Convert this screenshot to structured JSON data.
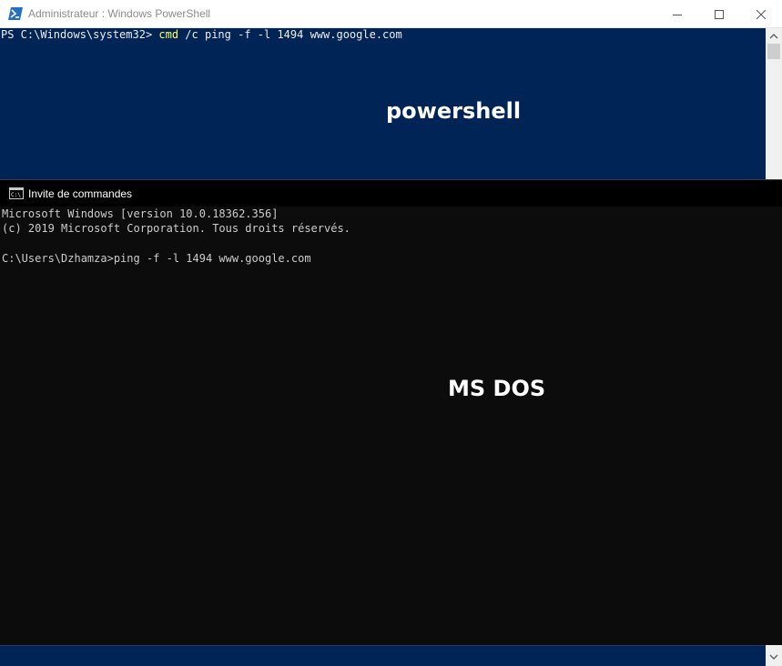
{
  "powershell": {
    "title": "Administrateur : Windows PowerShell",
    "prompt": "PS C:\\Windows\\system32> ",
    "command_keyword": "cmd",
    "command_args": " /c ping -f -l 1494 www.google.com",
    "overlay_label": "powershell",
    "icons": {
      "app": "powershell-icon",
      "minimize": "minimize-icon",
      "maximize": "maximize-icon",
      "close": "close-icon",
      "scroll_up": "chevron-up-icon"
    },
    "colors": {
      "background": "#012456",
      "command": "#ffff5a",
      "text": "#eeedf0"
    }
  },
  "cmd": {
    "title": "Invite de commandes",
    "lines": [
      "Microsoft Windows [version 10.0.18362.356]",
      "(c) 2019 Microsoft Corporation. Tous droits réservés.",
      "",
      "C:\\Users\\Dzhamza>ping -f -l 1494 www.google.com"
    ],
    "overlay_label": "MS DOS",
    "icons": {
      "app": "cmd-icon",
      "scroll_down": "chevron-down-icon"
    },
    "colors": {
      "background": "#0c0c0c",
      "text": "#cccccc"
    }
  }
}
